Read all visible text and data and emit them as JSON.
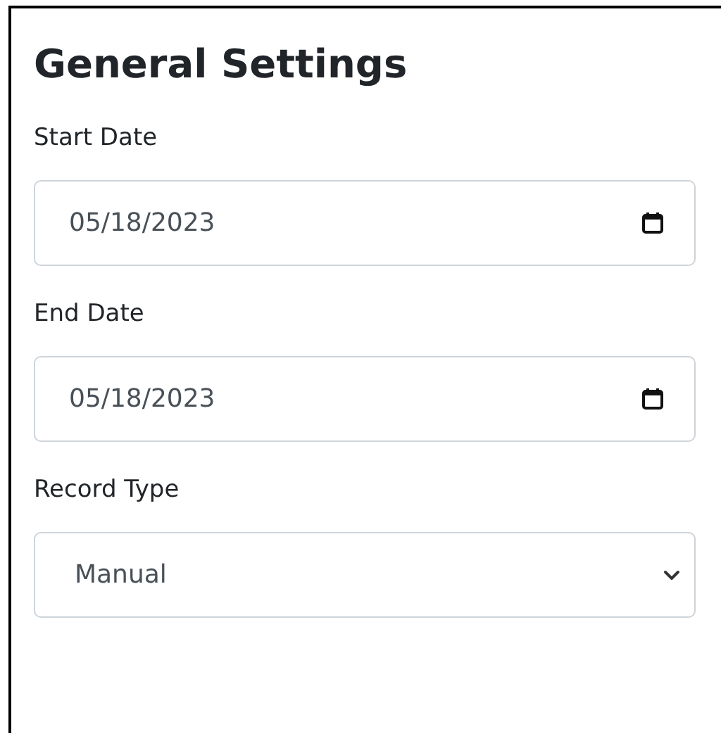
{
  "title": "General Settings",
  "fields": [
    {
      "label": "Start Date",
      "kind": "date",
      "value": "05/18/2023"
    },
    {
      "label": "End Date",
      "kind": "date",
      "value": "05/18/2023"
    },
    {
      "label": "Record Type",
      "kind": "select",
      "value": "Manual"
    }
  ]
}
